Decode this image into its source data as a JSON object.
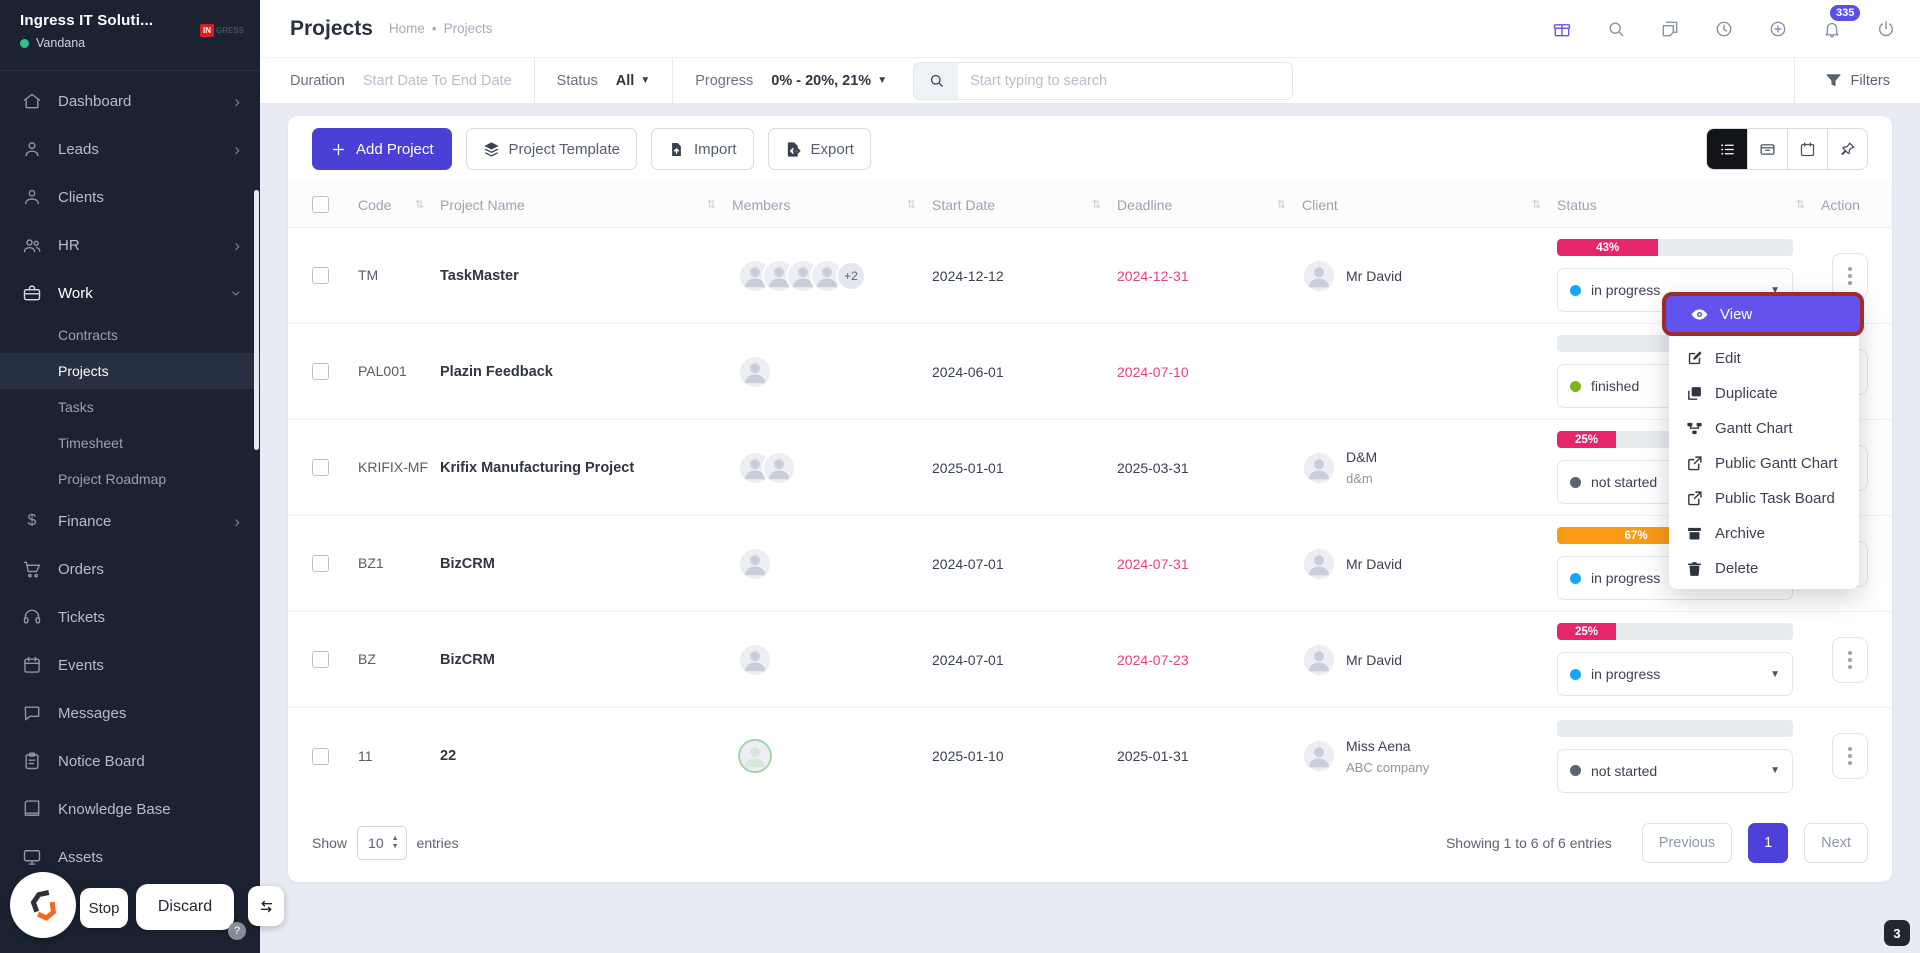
{
  "colors": {
    "accent": "#4b40d6",
    "menu_highlight": "#6153ec",
    "highlight_ring": "#9e2c2c",
    "progress_pink": "#e7256b",
    "progress_orange": "#f99b16",
    "overdue_red": "#ec3f72",
    "dot_in_progress": "#1aa7f1",
    "dot_finished": "#7eb31b",
    "dot_not_started": "#5b6372",
    "sidebar_bg": "#1b2232",
    "active_toggle": "#121418",
    "notification_badge": "#5b4ee8"
  },
  "sidebar": {
    "company": "Ingress IT Soluti...",
    "user": "Vandana",
    "brand_badge": "IN",
    "brand_rest": "GRESS",
    "items": [
      {
        "label": "Dashboard"
      },
      {
        "label": "Leads"
      },
      {
        "label": "Clients"
      },
      {
        "label": "HR"
      },
      {
        "label": "Work"
      },
      {
        "label": "Finance"
      },
      {
        "label": "Orders"
      },
      {
        "label": "Tickets"
      },
      {
        "label": "Events"
      },
      {
        "label": "Messages"
      },
      {
        "label": "Notice Board"
      },
      {
        "label": "Knowledge Base"
      },
      {
        "label": "Assets"
      }
    ],
    "work_children": [
      {
        "label": "Contracts"
      },
      {
        "label": "Projects"
      },
      {
        "label": "Tasks"
      },
      {
        "label": "Timesheet"
      },
      {
        "label": "Project Roadmap"
      }
    ]
  },
  "topbar": {
    "notification_count": "335"
  },
  "header": {
    "title": "Projects",
    "breadcrumb_home": "Home",
    "breadcrumb_sep": "•",
    "breadcrumb_current": "Projects"
  },
  "filters": {
    "duration_label": "Duration",
    "duration_placeholder": "Start Date To End Date",
    "status_label": "Status",
    "status_value": "All",
    "progress_label": "Progress",
    "progress_value": "0% - 20%, 21%",
    "search_placeholder": "Start typing to search",
    "filters_label": "Filters"
  },
  "actions": {
    "add_project": "Add Project",
    "project_template": "Project Template",
    "import": "Import",
    "export": "Export"
  },
  "table": {
    "headers": {
      "code": "Code",
      "name": "Project Name",
      "members": "Members",
      "start": "Start Date",
      "deadline": "Deadline",
      "client": "Client",
      "status": "Status",
      "action": "Action"
    },
    "rows": [
      {
        "code": "TM",
        "name": "TaskMaster",
        "members_extra": "+2",
        "start": "2024-12-12",
        "deadline": "2024-12-31",
        "client": "Mr David",
        "client_sub": "",
        "progress": 43,
        "progress_label": "43%",
        "status": "in progress"
      },
      {
        "code": "PAL001",
        "name": "Plazin Feedback",
        "members_extra": "",
        "start": "2024-06-01",
        "deadline": "2024-07-10",
        "client": "",
        "client_sub": "",
        "progress": 0,
        "progress_label": "",
        "status": "finished"
      },
      {
        "code": "KRIFIX-MF",
        "name": "Krifix Manufacturing Project",
        "members_extra": "",
        "start": "2025-01-01",
        "deadline": "2025-03-31",
        "client": "D&M",
        "client_sub": "d&m",
        "progress": 25,
        "progress_label": "25%",
        "status": "not started"
      },
      {
        "code": "BZ1",
        "name": "BizCRM",
        "members_extra": "",
        "start": "2024-07-01",
        "deadline": "2024-07-31",
        "client": "Mr David",
        "client_sub": "",
        "progress": 67,
        "progress_label": "67%",
        "status": "in progress"
      },
      {
        "code": "BZ",
        "name": "BizCRM",
        "members_extra": "",
        "start": "2024-07-01",
        "deadline": "2024-07-23",
        "client": "Mr David",
        "client_sub": "",
        "progress": 25,
        "progress_label": "25%",
        "status": "in progress"
      },
      {
        "code": "11",
        "name": "22",
        "members_extra": "",
        "start": "2025-01-10",
        "deadline": "2025-01-31",
        "client": "Miss Aena",
        "client_sub": "ABC company",
        "progress": 0,
        "progress_label": "",
        "status": "not started"
      }
    ]
  },
  "context_menu": {
    "items": [
      {
        "label": "View"
      },
      {
        "label": "Edit"
      },
      {
        "label": "Duplicate"
      },
      {
        "label": "Gantt Chart"
      },
      {
        "label": "Public Gantt Chart"
      },
      {
        "label": "Public Task Board"
      },
      {
        "label": "Archive"
      },
      {
        "label": "Delete"
      }
    ]
  },
  "footer": {
    "show_label": "Show",
    "show_value": "10",
    "entries_label": "entries",
    "summary": "Showing 1 to 6 of 6 entries",
    "previous": "Previous",
    "page": "1",
    "next": "Next"
  },
  "agent_bar": {
    "stop": "Stop",
    "discard": "Discard",
    "help": "?"
  },
  "page_badge": "3"
}
